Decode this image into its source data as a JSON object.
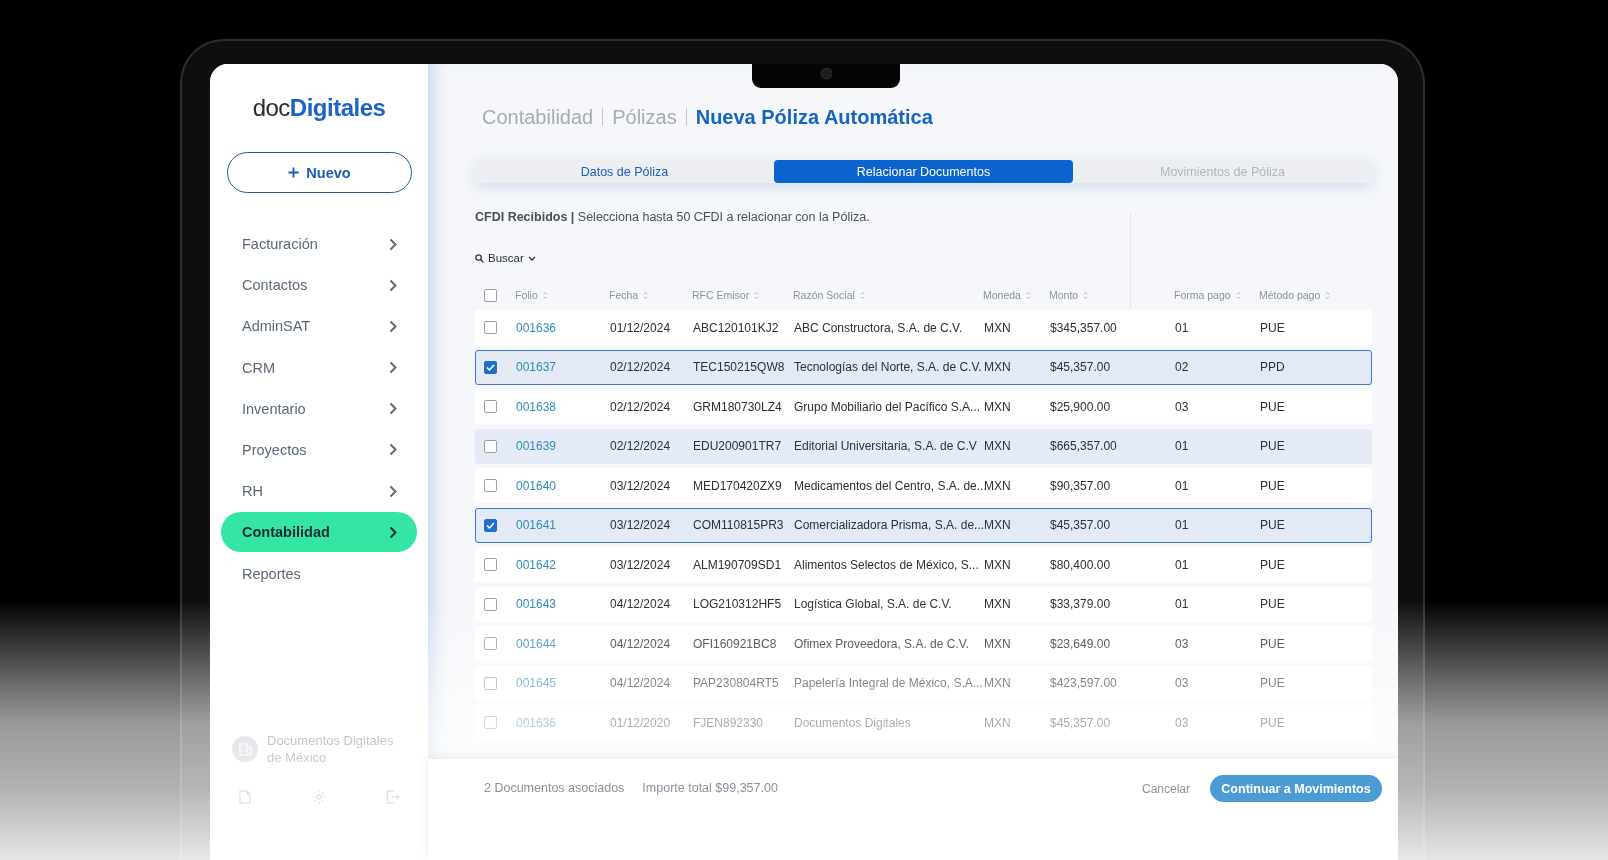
{
  "brand": {
    "prefix": "doc",
    "name": "Digitales"
  },
  "sidebar": {
    "new_button": {
      "label": "Nuevo"
    },
    "items": [
      {
        "label": "Facturación",
        "selected": false,
        "expandable": true
      },
      {
        "label": "Contactos",
        "selected": false,
        "expandable": true
      },
      {
        "label": "AdminSAT",
        "selected": false,
        "expandable": true
      },
      {
        "label": "CRM",
        "selected": false,
        "expandable": true
      },
      {
        "label": "Inventario",
        "selected": false,
        "expandable": true
      },
      {
        "label": "Proyectos",
        "selected": false,
        "expandable": true
      },
      {
        "label": "RH",
        "selected": false,
        "expandable": true
      },
      {
        "label": "Contabilidad",
        "selected": true,
        "expandable": true
      },
      {
        "label": "Reportes",
        "selected": false,
        "expandable": false
      }
    ],
    "company": {
      "name": "Documentos Digitales de México"
    }
  },
  "breadcrumb": [
    {
      "label": "Contabilidad",
      "current": false
    },
    {
      "label": "Pólizas",
      "current": false
    },
    {
      "label": "Nueva Póliza Automática",
      "current": true
    }
  ],
  "tabs": [
    {
      "label": "Datos de Póliza",
      "selected": false,
      "disabled": false
    },
    {
      "label": "Relacionar Documentos",
      "selected": true,
      "disabled": false
    },
    {
      "label": "Movimientos de Póliza",
      "selected": false,
      "disabled": true
    }
  ],
  "section": {
    "text": "**CFDI Recibidos |** Selecciona hasta 50 CFDI a relacionar con la Póliza."
  },
  "search": {
    "label": "Buscar"
  },
  "table": {
    "select_all": {
      "checked": false
    },
    "columns": [
      "Folio",
      "Fecha",
      "RFC Emisor",
      "Razón Social",
      "Moneda",
      "Monto",
      "Forma pago",
      "Método pago"
    ],
    "rows": [
      {
        "cells": [
          "001636",
          "01/12/2024",
          "ABC120101KJ2",
          "ABC Constructora, S.A. de C.V.",
          "MXN",
          "$345,357.00",
          "01",
          "PUE"
        ],
        "checked": false,
        "hovered": false
      },
      {
        "cells": [
          "001637",
          "02/12/2024",
          "TEC150215QW8",
          "Tecnologías del Norte, S.A. de C.V.",
          "MXN",
          "$45,357.00",
          "02",
          "PPD"
        ],
        "checked": true,
        "hovered": false
      },
      {
        "cells": [
          "001638",
          "02/12/2024",
          "GRM180730LZ4",
          "Grupo Mobiliario del Pacífico S.A...",
          "MXN",
          "$25,900.00",
          "03",
          "PUE"
        ],
        "checked": false,
        "hovered": false
      },
      {
        "cells": [
          "001639",
          "02/12/2024",
          "EDU200901TR7",
          "Editorial Universitaria, S.A. de C.V",
          "MXN",
          "$665,357.00",
          "01",
          "PUE"
        ],
        "checked": false,
        "hovered": true
      },
      {
        "cells": [
          "001640",
          "03/12/2024",
          "MED170420ZX9",
          "Medicamentos del Centro, S.A. de...",
          "MXN",
          "$90,357.00",
          "01",
          "PUE"
        ],
        "checked": false,
        "hovered": false
      },
      {
        "cells": [
          "001641",
          "03/12/2024",
          "COM110815PR3",
          "Comercializadora Prisma, S.A. de...",
          "MXN",
          "$45,357.00",
          "01",
          "PUE"
        ],
        "checked": true,
        "hovered": false
      },
      {
        "cells": [
          "001642",
          "03/12/2024",
          "ALM190709SD1",
          "Alimentos Selectos de México, S...",
          "MXN",
          "$80,400.00",
          "01",
          "PUE"
        ],
        "checked": false,
        "hovered": false
      },
      {
        "cells": [
          "001643",
          "04/12/2024",
          "LOG210312HF5",
          "Logística Global, S.A. de C.V.",
          "MXN",
          "$33,379.00",
          "01",
          "PUE"
        ],
        "checked": false,
        "hovered": false
      },
      {
        "cells": [
          "001644",
          "04/12/2024",
          "OFI160921BC8",
          "Ofimex Proveedora, S.A. de C.V.",
          "MXN",
          "$23,649.00",
          "03",
          "PUE"
        ],
        "checked": false,
        "hovered": false
      },
      {
        "cells": [
          "001645",
          "04/12/2024",
          "PAP230804RT5",
          "Papelería Integral de México, S.A...",
          "MXN",
          "$423,597.00",
          "03",
          "PUE"
        ],
        "checked": false,
        "hovered": false
      },
      {
        "cells": [
          "001636",
          "01/12/2020",
          "FJEN892330",
          "Documentos Digitales",
          "MXN",
          "$45,357.00",
          "03",
          "PUE"
        ],
        "checked": false,
        "hovered": false
      }
    ]
  },
  "footer": {
    "count": "2 Documentos asociados",
    "total": "Importe total $99,357.00",
    "cancel": "Cancelar",
    "continue": "Continuar a Movimientos"
  }
}
